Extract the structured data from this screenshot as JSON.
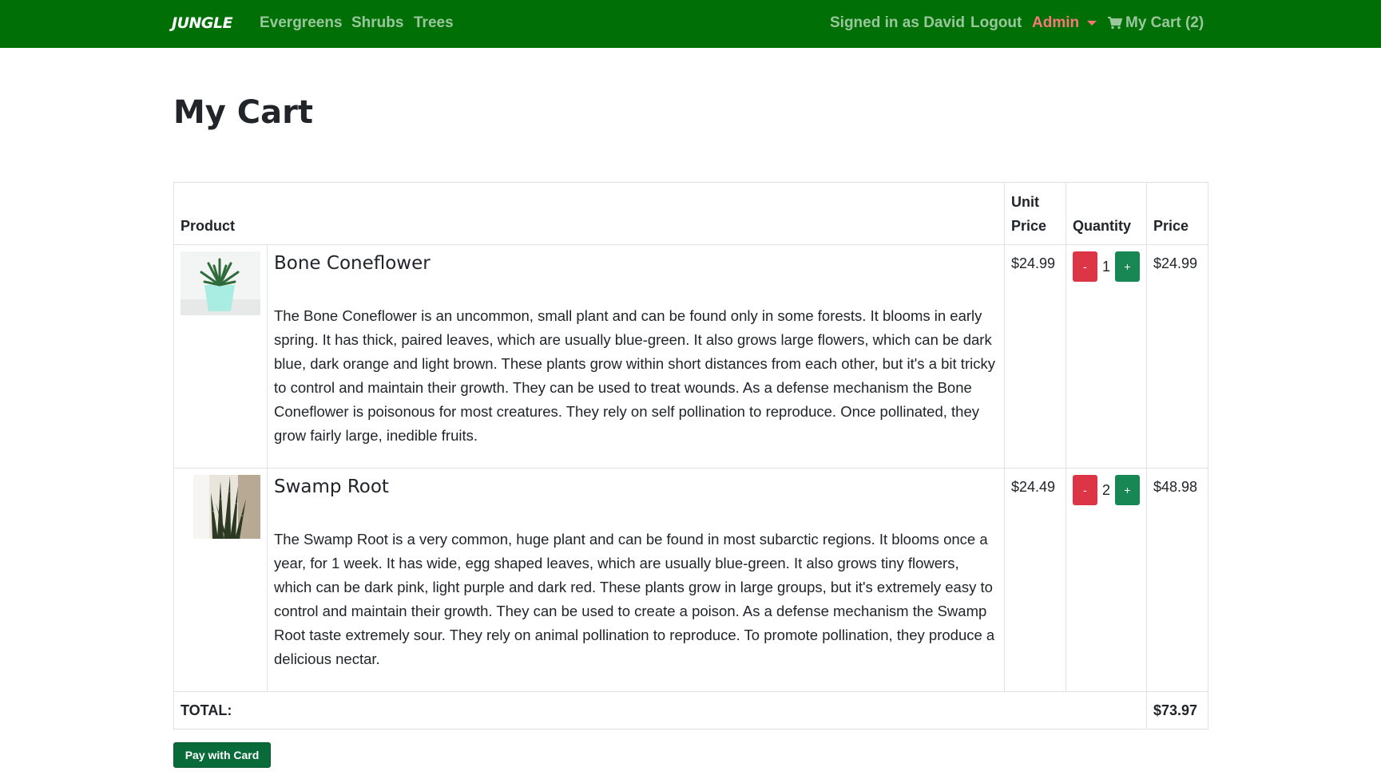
{
  "navbar": {
    "brand": "JUNGLE",
    "links": [
      "Evergreens",
      "Shrubs",
      "Trees"
    ],
    "signed_in": "Signed in as David",
    "logout": "Logout",
    "admin": "Admin",
    "cart": "My Cart (2)",
    "colors": {
      "background": "#007006",
      "admin": "#f87878"
    }
  },
  "page": {
    "title": "My Cart"
  },
  "table": {
    "headers": {
      "product": "Product",
      "unit_price": "Unit Price",
      "quantity": "Quantity",
      "price": "Price"
    },
    "items": [
      {
        "name": "Bone Coneflower",
        "description": "The Bone Coneflower is an uncommon, small plant and can be found only in some forests. It blooms in early spring. It has thick, paired leaves, which are usually blue-green. It also grows large flowers, which can be dark blue, dark orange and light brown. These plants grow within short distances from each other, but it's a bit tricky to control and maintain their growth. They can be used to treat wounds. As a defense mechanism the Bone Coneflower is poisonous for most creatures. They rely on self pollination to reproduce. Once pollinated, they grow fairly large, inedible fruits.",
        "unit_price": "$24.99",
        "quantity": "1",
        "price": "$24.99",
        "minus": "-",
        "plus": "+",
        "image_icon": "succulent-in-pot"
      },
      {
        "name": "Swamp Root",
        "description": "The Swamp Root is a very common, huge plant and can be found in most subarctic regions. It blooms once a year, for 1 week. It has wide, egg shaped leaves, which are usually blue-green. It also grows tiny flowers, which can be dark pink, light purple and dark red. These plants grow in large groups, but it's extremely easy to control and maintain their growth. They can be used to create a poison. As a defense mechanism the Swamp Root taste extremely sour. They rely on animal pollination to reproduce. To promote pollination, they produce a delicious nectar.",
        "unit_price": "$24.49",
        "quantity": "2",
        "price": "$48.98",
        "minus": "-",
        "plus": "+",
        "image_icon": "snake-plant"
      }
    ],
    "total_label": "TOTAL:",
    "total_value": "$73.97"
  },
  "pay_button": "Pay with Card"
}
